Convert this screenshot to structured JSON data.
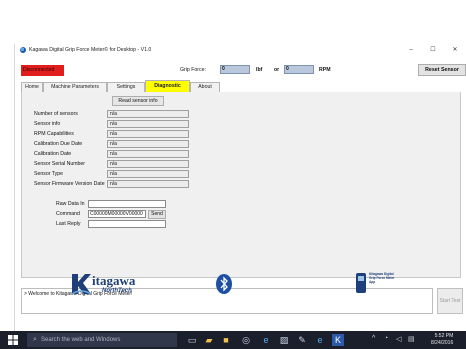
{
  "window": {
    "title": "Kagawa Digital Grip Force Meter© for Desktop - V1.0",
    "minimize_glyph": "–",
    "maximize_glyph": "☐",
    "close_glyph": "✕"
  },
  "toolbar": {
    "status_button": "Disconnected",
    "grip_force_label": "Grip Force:",
    "grip_force_value": "0",
    "force_unit": "lbf",
    "or_label": "or",
    "rpm_value": "0",
    "rpm_unit": "RPM",
    "reset_button": "Reset Sensor",
    "status_color": "#e01e1e"
  },
  "tabs": [
    {
      "label": "Home"
    },
    {
      "label": "Machine Parameters"
    },
    {
      "label": "Settings"
    },
    {
      "label": "Diagnostic",
      "active": true
    },
    {
      "label": "About"
    }
  ],
  "diagnostic": {
    "read_button": "Read sensor info",
    "fields": [
      {
        "label": "Number of sensors",
        "value": "n/a"
      },
      {
        "label": "Sensor info",
        "value": "n/a"
      },
      {
        "label": "RPM Capabilities",
        "value": "n/a"
      },
      {
        "label": "Calibration Due Date",
        "value": "n/a"
      },
      {
        "label": "Calibration Date",
        "value": "n/a"
      },
      {
        "label": "Sensor Serial Number",
        "value": "n/a"
      },
      {
        "label": "Sensor Type",
        "value": "n/a"
      },
      {
        "label": "Sensor Firmware Version Date",
        "value": "n/a"
      }
    ],
    "raw_data_in_label": "Raw Data In",
    "raw_data_in_value": "",
    "command_label": "Command",
    "command_value": "C00000M00000V00000",
    "send_button": "Send",
    "last_reply_label": "Last Reply",
    "last_reply_value": ""
  },
  "log": {
    "message": "> Welcome to Kitagawa Digital Grip Force Meter!"
  },
  "start_test_button": "Start Test",
  "footer": {
    "brand_name": "itagawa",
    "brand_sub": "NorthTech",
    "badge_text": "Kitagawa Digital Grip Force Meter App"
  },
  "taskbar": {
    "search_placeholder": "Search the web and Windows",
    "time": "5:52 PM",
    "date": "8/24/2016"
  }
}
